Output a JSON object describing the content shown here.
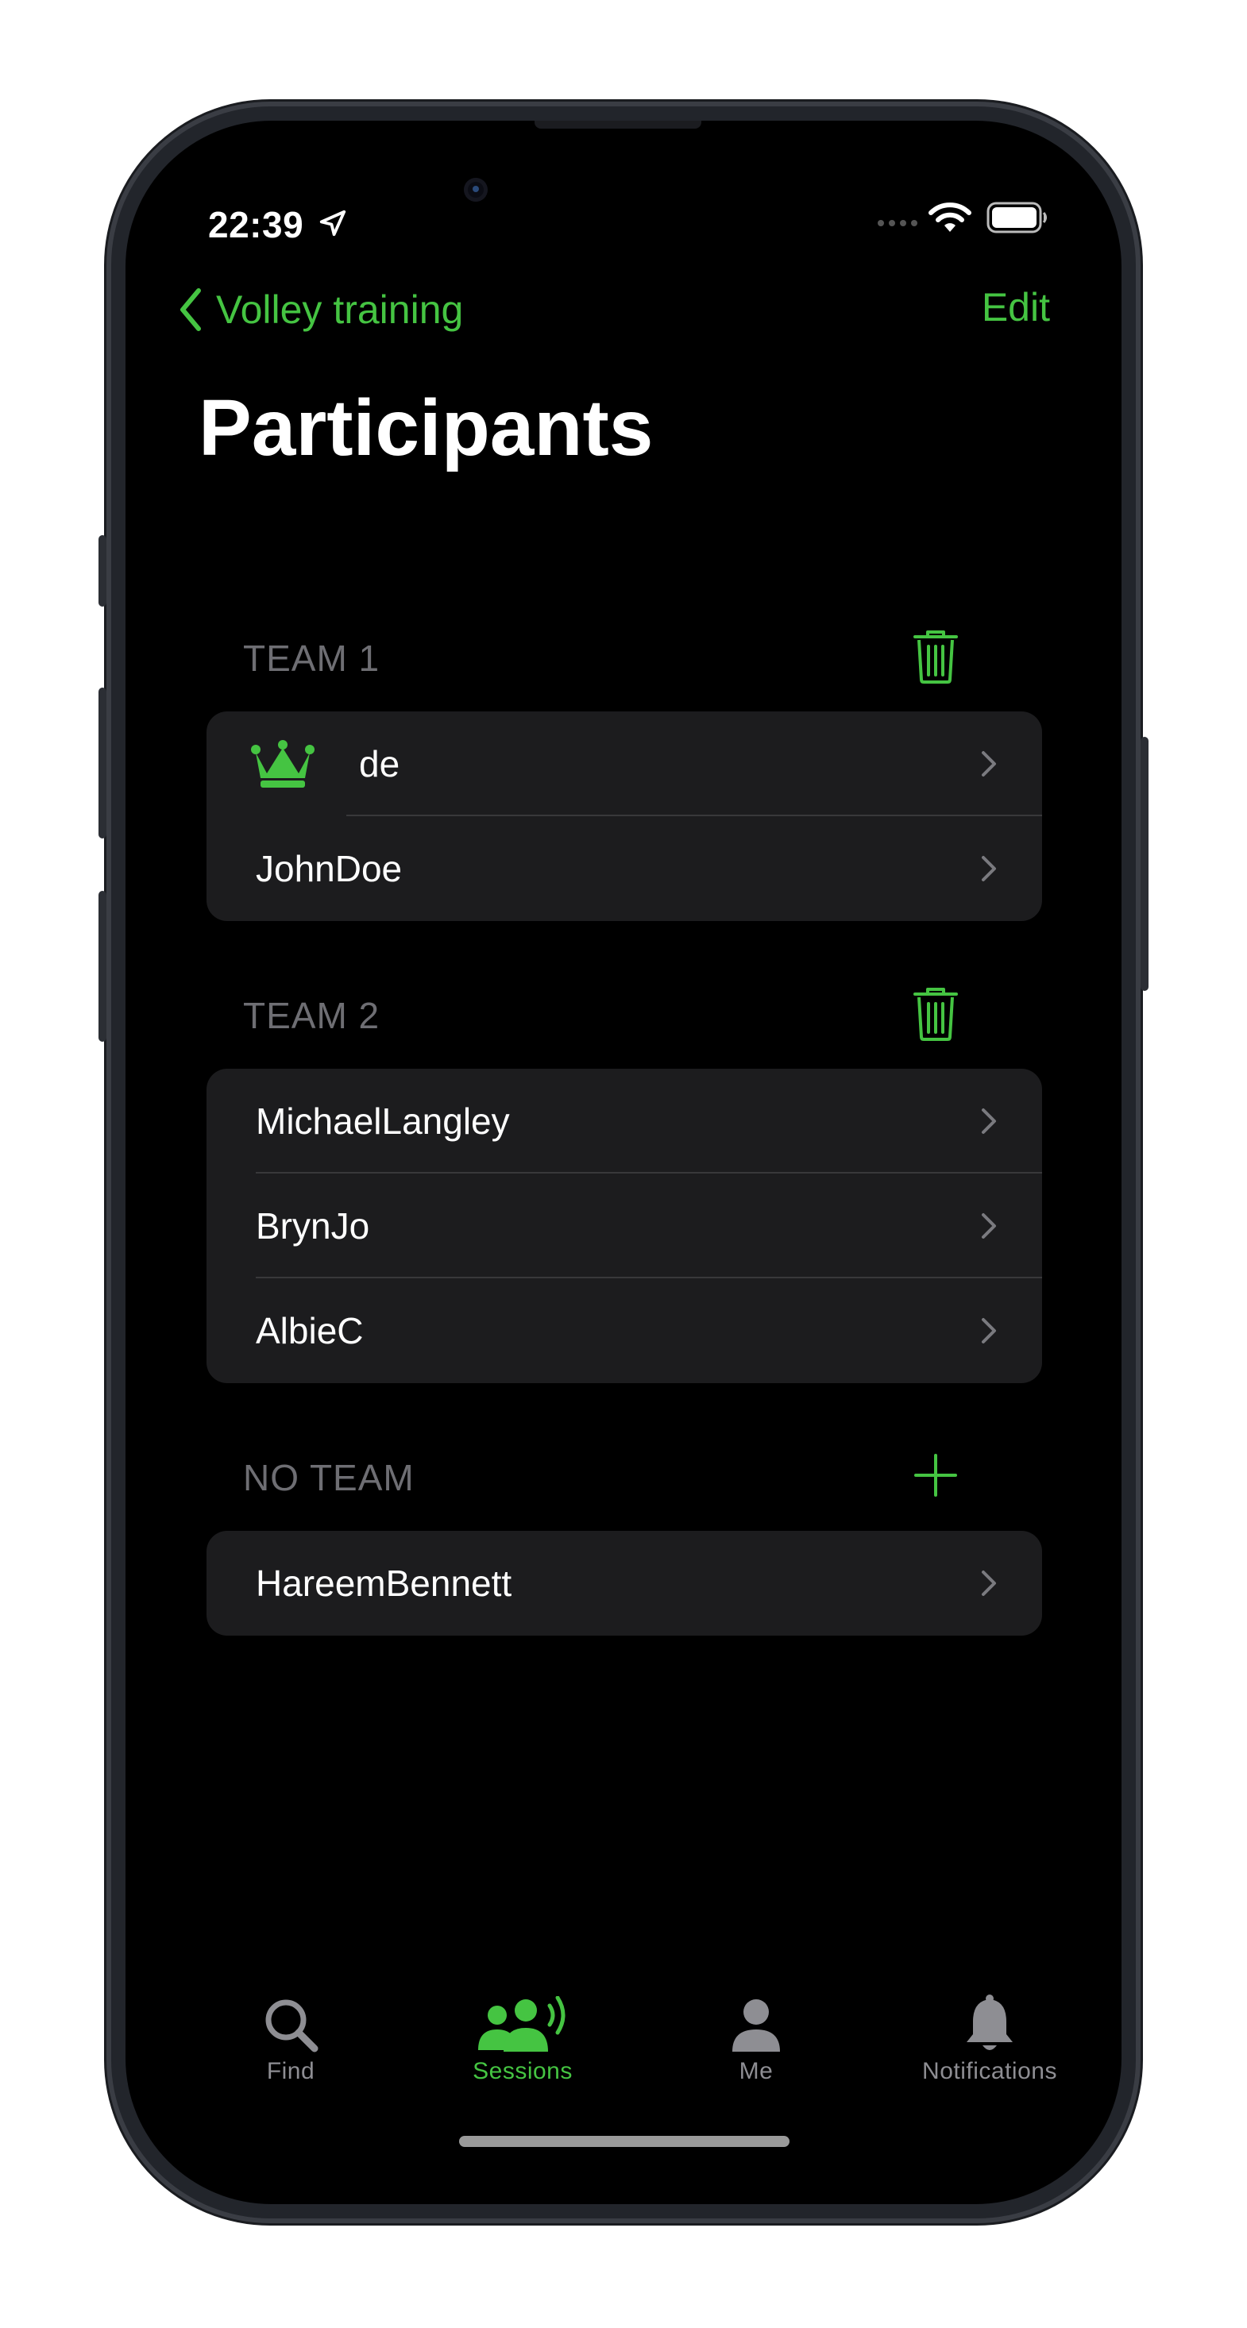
{
  "status_bar": {
    "time": "22:39",
    "location_icon": "location-arrow-icon",
    "signal_icon": "cellular-signal-icon",
    "wifi_icon": "wifi-icon",
    "battery_icon": "battery-icon"
  },
  "nav": {
    "back_label": "Volley training",
    "back_icon": "chevron-left-icon",
    "edit_label": "Edit"
  },
  "page": {
    "title": "Participants"
  },
  "sections": [
    {
      "title": "TEAM 1",
      "action_icon": "trash-icon",
      "participants": [
        {
          "name": "de",
          "badge_icon": "crown-icon"
        },
        {
          "name": "JohnDoe"
        }
      ]
    },
    {
      "title": "TEAM 2",
      "action_icon": "trash-icon",
      "participants": [
        {
          "name": "MichaelLangley"
        },
        {
          "name": "BrynJo"
        },
        {
          "name": "AlbieC"
        }
      ]
    },
    {
      "title": "NO TEAM",
      "action_icon": "plus-icon",
      "participants": [
        {
          "name": "HareemBennett"
        }
      ]
    }
  ],
  "tab_bar": {
    "tabs": [
      {
        "label": "Find",
        "icon": "magnifying-glass-icon",
        "active": false
      },
      {
        "label": "Sessions",
        "icon": "people-broadcast-icon",
        "active": true
      },
      {
        "label": "Me",
        "icon": "person-icon",
        "active": false
      },
      {
        "label": "Notifications",
        "icon": "bell-icon",
        "active": false
      }
    ]
  },
  "colors": {
    "accent": "#45c442",
    "background": "#000000",
    "cell_background": "#1c1c1e",
    "secondary_text": "#6e6e73",
    "inactive_tab": "#8e8e93",
    "separator": "#38383a"
  }
}
